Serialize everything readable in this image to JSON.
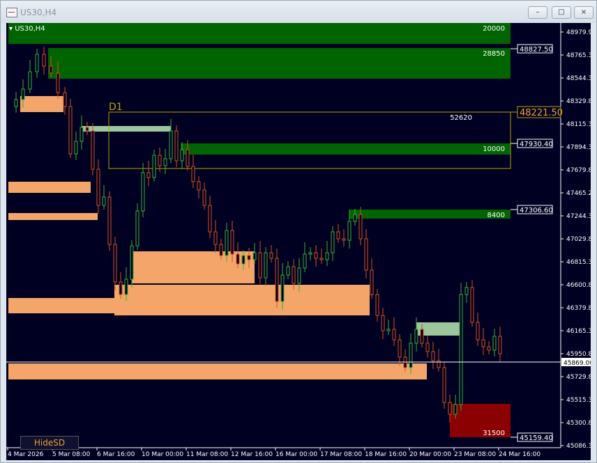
{
  "window": {
    "title": "US30,H4",
    "btn_min": "–",
    "btn_max": "□",
    "btn_close": "×"
  },
  "chart_header": {
    "symbol_label": "US30,H4"
  },
  "buttons": {
    "hidesd": "HideSD"
  },
  "colors": {
    "background": "#000022",
    "demand": "#f4a66a",
    "supply": "#006400",
    "flip": "#9cc79c",
    "bull_candle": "#35b335",
    "bear_candle": "#d8501e",
    "d1_box": "#b8a200",
    "strong_demand": "#8b0000"
  },
  "price_axis": {
    "ticks": [
      "48979.90",
      "48765.30",
      "48544.35",
      "48329.80",
      "48115.30",
      "47894.35",
      "47679.80",
      "47465.25",
      "47244.30",
      "47029.80",
      "46815.30",
      "46600.80",
      "46379.80",
      "46165.30",
      "45950.80",
      "45729.80",
      "45515.30",
      "45300.80",
      "45086.30"
    ],
    "tagged": [
      {
        "label": "48827.50",
        "price": 48827.5
      },
      {
        "label": "47930.40",
        "price": 47930.4
      },
      {
        "label": "47306.60",
        "price": 47306.6
      },
      {
        "label": "45159.40",
        "price": 45159.4
      }
    ],
    "d1_level": "48221.50",
    "current_price": "45869.00"
  },
  "time_axis": [
    "4 Mar 2026",
    "5 Mar 08:00",
    "6 Mar 16:00",
    "10 Mar 00:00",
    "11 Mar 08:00",
    "12 Mar 16:00",
    "16 Mar 00:00",
    "17 Mar 08:00",
    "18 Mar 16:00",
    "20 Mar 00:00",
    "23 Mar 08:00",
    "24 Mar 16:00"
  ],
  "zones": [
    {
      "type": "supply",
      "label": "20000"
    },
    {
      "type": "supply",
      "label": "28850"
    },
    {
      "type": "supply",
      "label": "10000"
    },
    {
      "type": "supply",
      "label": "8400"
    },
    {
      "type": "d1",
      "label": "52620",
      "title": "D1"
    },
    {
      "type": "demand_strong",
      "label": "31500"
    }
  ]
}
